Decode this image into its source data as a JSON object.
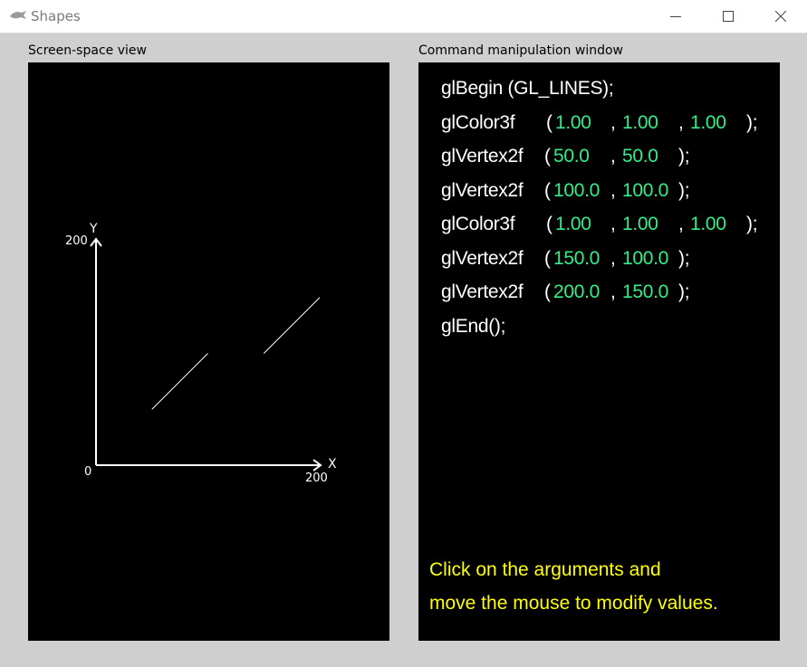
{
  "window": {
    "title": "Shapes",
    "icon": "app-icon",
    "controls": {
      "minimize": "minimize-icon",
      "maximize": "maximize-icon",
      "close": "close-icon"
    }
  },
  "left_panel": {
    "label": "Screen-space view",
    "axes": {
      "y_label": "Y",
      "x_label": "X",
      "y_max_label": "200",
      "x_max_label": "200",
      "origin_label": "0",
      "range": [
        0,
        200
      ]
    },
    "lines": [
      {
        "x1": 50.0,
        "y1": 50.0,
        "x2": 100.0,
        "y2": 100.0,
        "color": "#ffffff"
      },
      {
        "x1": 150.0,
        "y1": 100.0,
        "x2": 200.0,
        "y2": 150.0,
        "color": "#ffffff"
      }
    ]
  },
  "right_panel": {
    "label": "Command manipulation window",
    "lines": {
      "begin": "glBegin (GL_LINES);",
      "color1": {
        "fn": "glColor3f",
        "open": "(",
        "a": "1.00",
        "sep1": ",",
        "b": "1.00",
        "sep2": ",",
        "c": "1.00",
        "close": ");"
      },
      "vertex1": {
        "fn": "glVertex2f",
        "open": "(",
        "a": "50.0",
        "sep1": ",",
        "b": "50.0",
        "close": ");"
      },
      "vertex2": {
        "fn": "glVertex2f",
        "open": "(",
        "a": "100.0",
        "sep1": ",",
        "b": "100.0",
        "close": ");"
      },
      "color2": {
        "fn": "glColor3f",
        "open": "(",
        "a": "1.00",
        "sep1": ",",
        "b": "1.00",
        "sep2": ",",
        "c": "1.00",
        "close": ");"
      },
      "vertex3": {
        "fn": "glVertex2f",
        "open": "(",
        "a": "150.0",
        "sep1": ",",
        "b": "100.0",
        "close": ");"
      },
      "vertex4": {
        "fn": "glVertex2f",
        "open": "(",
        "a": "200.0",
        "sep1": ",",
        "b": "150.0",
        "close": ");"
      },
      "end": "glEnd();"
    },
    "hint_line1": "Click on the arguments and",
    "hint_line2": "move the mouse to modify values."
  },
  "colors": {
    "background": "#cfcfcf",
    "argument": "#33ee88",
    "hint": "#ffff00",
    "code": "#ffffff"
  }
}
